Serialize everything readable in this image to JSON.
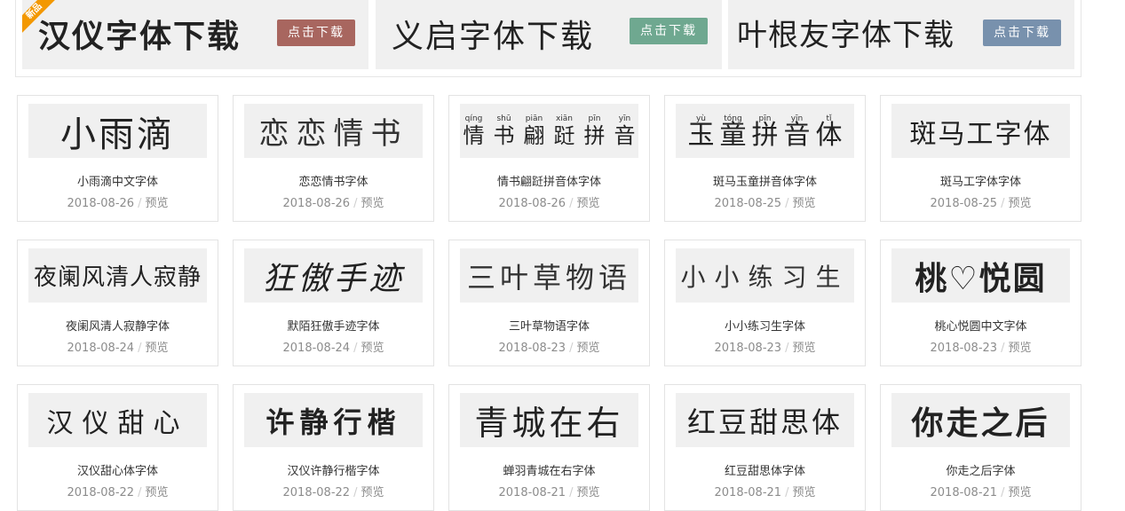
{
  "banners": [
    {
      "title": "汉仪字体下载",
      "button": "点击下载",
      "button_color": "#a8665f",
      "ribbon": "新品"
    },
    {
      "title": "义启字体下载",
      "button": "点击下载",
      "button_color": "#6fa890"
    },
    {
      "title": "叶根友字体下载",
      "button": "点击下载",
      "button_color": "#7891ad"
    }
  ],
  "cards": [
    {
      "preview": "小雨滴",
      "name": "小雨滴中文字体",
      "date": "2018-08-26",
      "link": "预览"
    },
    {
      "preview": "恋恋情书",
      "name": "恋恋情书字体",
      "date": "2018-08-26",
      "link": "预览"
    },
    {
      "preview_pinyin": [
        {
          "py": "qíng",
          "hz": "情"
        },
        {
          "py": "shū",
          "hz": "书"
        },
        {
          "py": "piān",
          "hz": "翩"
        },
        {
          "py": "xiān",
          "hz": "跹"
        },
        {
          "py": "pīn",
          "hz": "拼"
        },
        {
          "py": "yīn",
          "hz": "音"
        }
      ],
      "name": "情书翩跹拼音体字体",
      "date": "2018-08-26",
      "link": "预览"
    },
    {
      "preview_pinyin": [
        {
          "py": "yù",
          "hz": "玉"
        },
        {
          "py": "tóng",
          "hz": "童"
        },
        {
          "py": "pīn",
          "hz": "拼"
        },
        {
          "py": "yīn",
          "hz": "音"
        },
        {
          "py": "tǐ",
          "hz": "体"
        }
      ],
      "name": "斑马玉童拼音体字体",
      "date": "2018-08-25",
      "link": "预览"
    },
    {
      "preview": "斑马工字体",
      "name": "斑马工字体字体",
      "date": "2018-08-25",
      "link": "预览"
    },
    {
      "preview": "夜阑风清人寂静",
      "name": "夜阑风清人寂静字体",
      "date": "2018-08-24",
      "link": "预览"
    },
    {
      "preview": "狂傲手迹",
      "name": "默陌狂傲手迹字体",
      "date": "2018-08-24",
      "link": "预览"
    },
    {
      "preview": "三叶草物语",
      "name": "三叶草物语字体",
      "date": "2018-08-23",
      "link": "预览"
    },
    {
      "preview": "小小练习生",
      "name": "小小练习生字体",
      "date": "2018-08-23",
      "link": "预览"
    },
    {
      "preview": "桃♡悦圆",
      "name": "桃心悦圆中文字体",
      "date": "2018-08-23",
      "link": "预览"
    },
    {
      "preview": "汉仪甜心",
      "name": "汉仪甜心体字体",
      "date": "2018-08-22",
      "link": "预览"
    },
    {
      "preview": "许静行楷",
      "name": "汉仪许静行楷字体",
      "date": "2018-08-22",
      "link": "预览"
    },
    {
      "preview": "青城在右",
      "name": "蝉羽青城在右字体",
      "date": "2018-08-21",
      "link": "预览"
    },
    {
      "preview": "红豆甜思体",
      "name": "红豆甜思体字体",
      "date": "2018-08-21",
      "link": "预览"
    },
    {
      "preview": "你走之后",
      "name": "你走之后字体",
      "date": "2018-08-21",
      "link": "预览"
    }
  ]
}
